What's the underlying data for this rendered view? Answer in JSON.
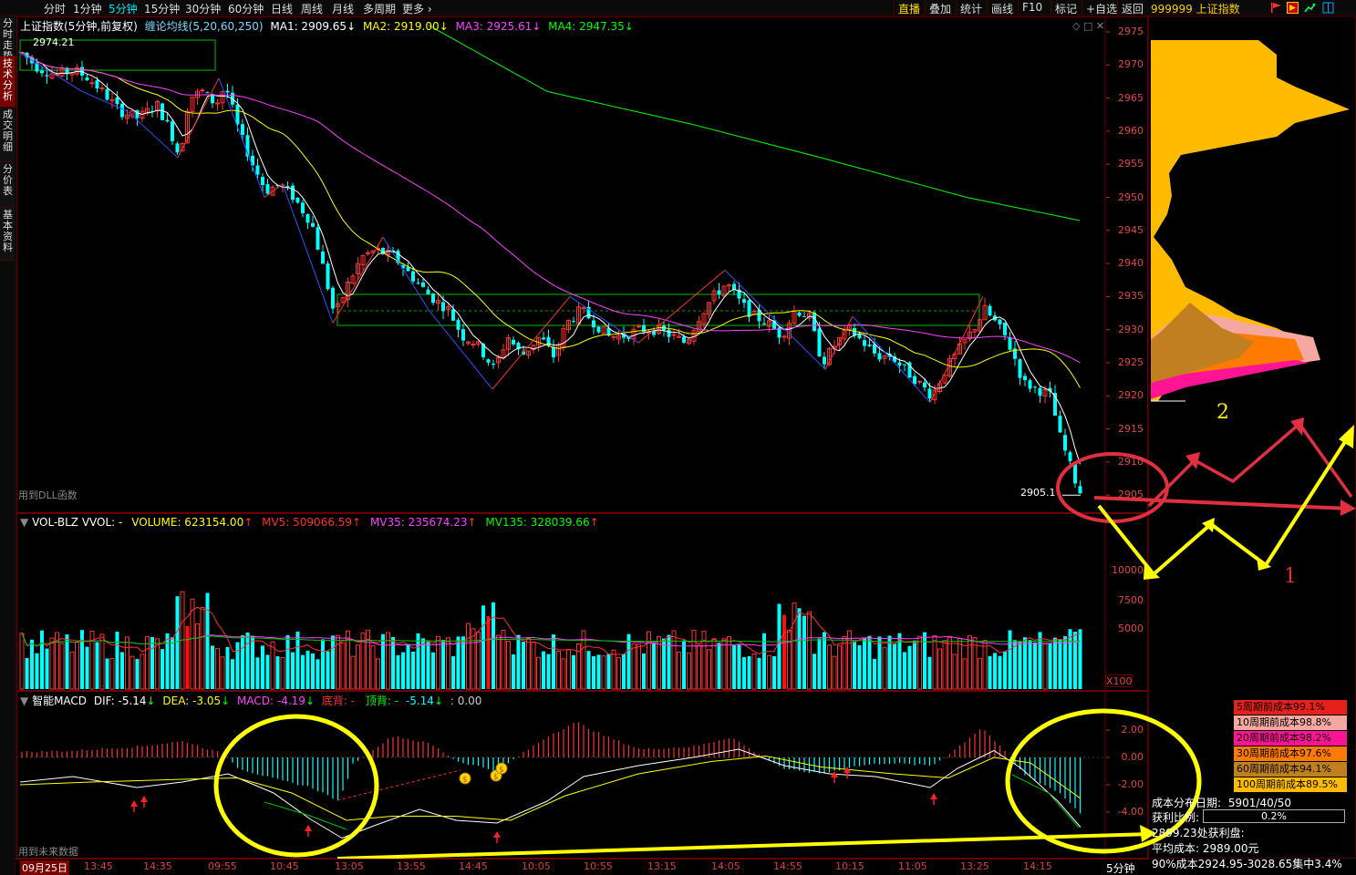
{
  "toolbar": {
    "periods": [
      "分时",
      "1分钟",
      "5分钟",
      "15分钟",
      "30分钟",
      "60分钟",
      "日线",
      "周线",
      "月线",
      "多周期",
      "更多 ›"
    ],
    "active_period_index": 2,
    "tools": [
      "直播",
      "叠加",
      "统计",
      "画线",
      "F10",
      "标记",
      "+自选",
      "返回"
    ],
    "right_code": "999999 上证指数"
  },
  "side_tabs": [
    "分时走势",
    "技术分析",
    "成交明细",
    "分价表",
    "基本资料"
  ],
  "active_side_tab_index": 1,
  "main_legend": {
    "title": "上证指数(5分钟,前复权)",
    "indicator": "缠论均线(5,20,60,250)",
    "ma1": "MA1: 2909.65",
    "ma2": "MA2: 2919.00",
    "ma3": "MA3: 2925.61",
    "ma4": "MA4: 2947.35",
    "high_label": "2974.21",
    "last_label": "2905.1",
    "dll_note": "用到DLL函数",
    "colors": {
      "ma1": "#ffffff",
      "ma2": "#ffff00",
      "ma3": "#ff40ff",
      "ma4": "#00ff00",
      "up": "#ff3030",
      "down": "#00ffff"
    }
  },
  "price_axis": [
    "2975",
    "2970",
    "2965",
    "2960",
    "2955",
    "2950",
    "2945",
    "2940",
    "2935",
    "2930",
    "2925",
    "2920",
    "2915",
    "2910",
    "2905"
  ],
  "volume_legend": {
    "name": "VOL-BLZ VVOL: -",
    "volume": "VOLUME: 623154.00",
    "mv5": "MV5: 509066.59",
    "mv35": "MV35: 235674.23",
    "mv135": "MV135: 328039.66"
  },
  "volume_axis": [
    "10000",
    "7500",
    "5000"
  ],
  "volume_unit": "X100",
  "macd_legend": {
    "name": "智能MACD",
    "dif": "DIF: -5.14",
    "dea": "DEA: -3.05",
    "macd": "MACD: -4.19",
    "bottom": "底背: -",
    "top": "顶背: -",
    "val1": "-5.14",
    "val2": ": 0.00",
    "future_note": "用到未来数据"
  },
  "macd_axis": [
    "2.00",
    "0.00",
    "-2.00",
    "-4.00"
  ],
  "time_axis": [
    "09月25日",
    "13:45",
    "14:35",
    "09:55",
    "10:45",
    "13:05",
    "13:55",
    "14:45",
    "10:05",
    "10:55",
    "13:15",
    "14:05",
    "14:55",
    "10:15",
    "11:05",
    "13:25",
    "14:15"
  ],
  "period_badge": "5分钟",
  "cost_legend": [
    {
      "label": "5周期前成本99.1%",
      "color": "#e8201c",
      "text": "#000000"
    },
    {
      "label": "10周期前成本98.8%",
      "color": "#f4a8a0",
      "text": "#000000"
    },
    {
      "label": "20周期前成本98.2%",
      "color": "#ff1493",
      "text": "#000000"
    },
    {
      "label": "30周期前成本97.6%",
      "color": "#ff7a00",
      "text": "#000000"
    },
    {
      "label": "60周期前成本94.1%",
      "color": "#c08020",
      "text": "#000000"
    },
    {
      "label": "100周期前成本89.5%",
      "color": "#ffbb00",
      "text": "#000000"
    }
  ],
  "cost_info": {
    "dist_label": "成本分布",
    "date_label": "日期:",
    "date_value": "5901/40/50",
    "profit_label": "获利比例:",
    "profit_value": "0.2%",
    "profit_line": "2899.23处获利盘:",
    "avg_cost": "平均成本:  2989.00元",
    "cost90": "90%成本2924.95-3028.65集中3.4%"
  },
  "annotations": {
    "label_1": "1",
    "label_2": "2"
  }
}
